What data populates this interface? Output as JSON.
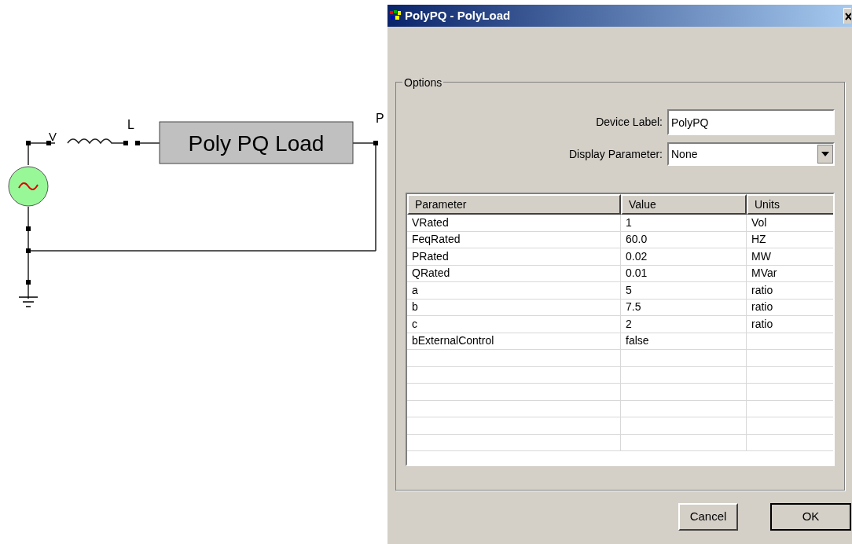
{
  "canvas": {
    "source_label": "V",
    "inductor_label": "L",
    "load_block": "Poly PQ Load",
    "load_label": "P"
  },
  "dialog": {
    "title": "PolyPQ - PolyLoad",
    "group": "Options",
    "device_label": {
      "label": "Device Label:",
      "value": "PolyPQ"
    },
    "display_parameter": {
      "label": "Display Parameter:",
      "value": "None"
    },
    "table": {
      "columns": [
        "Parameter",
        "Value",
        "Units"
      ],
      "rows": [
        [
          "VRated",
          "1",
          "Vol"
        ],
        [
          "FeqRated",
          "60.0",
          "HZ"
        ],
        [
          "PRated",
          "0.02",
          "MW"
        ],
        [
          "QRated",
          "0.01",
          "MVar"
        ],
        [
          "a",
          "5",
          "ratio"
        ],
        [
          "b",
          "7.5",
          "ratio"
        ],
        [
          "c",
          "2",
          "ratio"
        ],
        [
          "bExternalControl",
          "false",
          ""
        ]
      ]
    },
    "buttons": [
      {
        "label": "Cancel",
        "default": false
      },
      {
        "label": "OK",
        "default": true
      }
    ]
  }
}
